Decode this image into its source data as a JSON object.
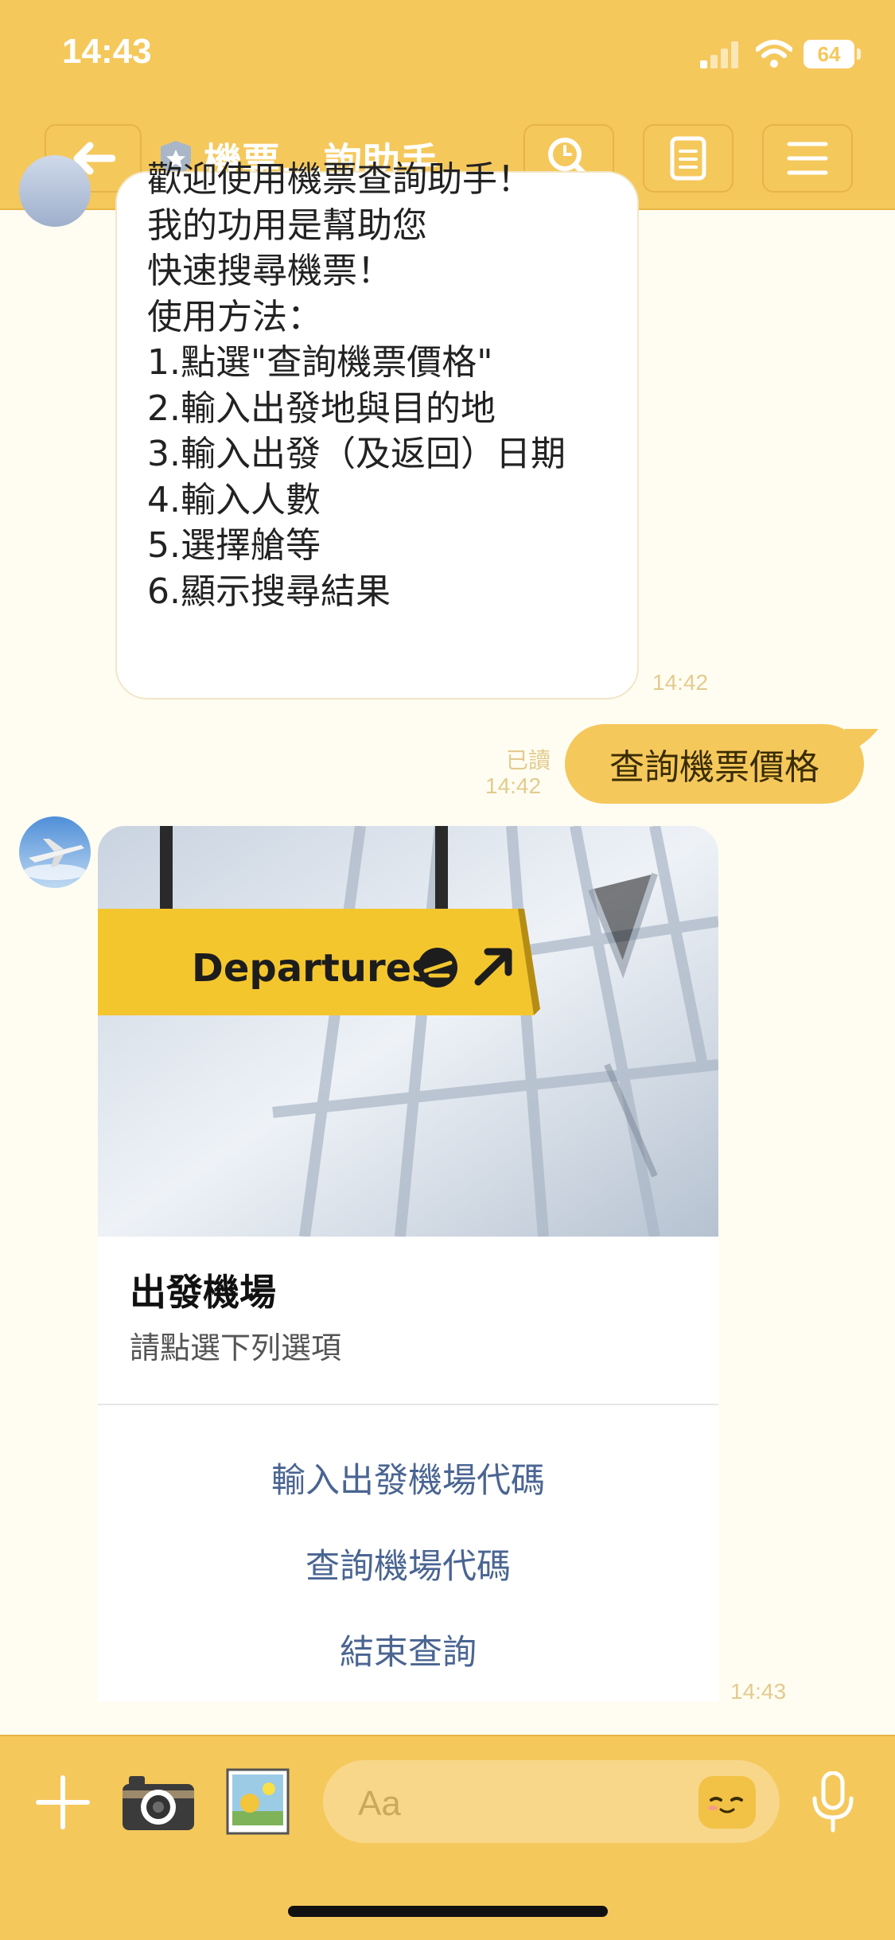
{
  "status": {
    "time": "14:43",
    "battery": "64"
  },
  "header": {
    "title": "機票...詢助手",
    "back": "back-arrow-icon",
    "search": "search-icon",
    "notes": "notes-icon",
    "menu": "menu-icon"
  },
  "messages": {
    "bot_intro": {
      "lines": [
        "歡迎使用機票查詢助手！",
        "我的功用是幫助您",
        "快速搜尋機票！",
        "",
        "使用方法：",
        "1.點選\"查詢機票價格\"",
        "2.輸入出發地與目的地",
        "3.輸入出發（及返回）日期",
        "4.輸入人數",
        "5.選擇艙等",
        "6.顯示搜尋結果"
      ],
      "time": "14:42"
    },
    "user_msg": {
      "text": "查詢機票價格",
      "read": "已讀",
      "time": "14:42"
    },
    "card": {
      "sign_text": "Departures",
      "title": "出發機場",
      "subtitle": "請點選下列選項",
      "buttons": [
        "輸入出發機場代碼",
        "查詢機場代碼",
        "結束查詢"
      ],
      "time": "14:43"
    }
  },
  "input": {
    "placeholder": "Aa"
  },
  "colors": {
    "theme": "#F5C85C",
    "background": "#FFFDF2",
    "link": "#4A6592"
  }
}
